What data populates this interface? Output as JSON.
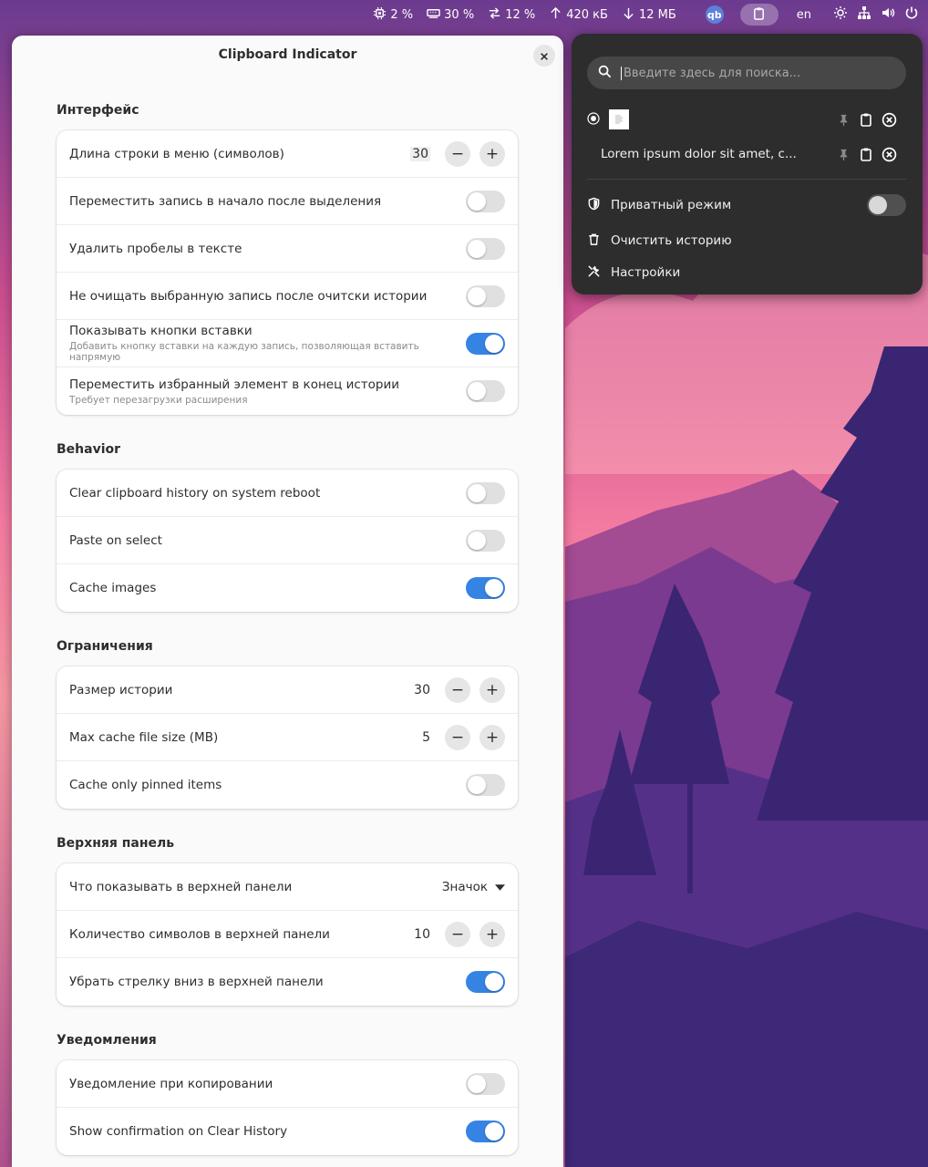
{
  "topbar": {
    "cpu": "2 %",
    "memory": "30 %",
    "swap": "12 %",
    "upload": "420 кБ",
    "download": "12 МБ",
    "app_badge": "qb",
    "keyboard_layout": "en"
  },
  "settings": {
    "title": "Clipboard Indicator",
    "sections": {
      "interface": {
        "title": "Интерфейс",
        "menu_line_length": {
          "label": "Длина строки в меню (символов)",
          "value": "30"
        },
        "move_to_top": {
          "label": "Переместить запись в начало после выделения",
          "on": false
        },
        "strip_whitespace": {
          "label": "Удалить пробелы в тексте",
          "on": false
        },
        "keep_selected": {
          "label": "Не очищать выбранную запись после очитски истории",
          "on": false
        },
        "show_paste_buttons": {
          "label": "Показывать кнопки вставки",
          "sub": "Добавить кнопку вставки на каждую запись, позволяющая вставить напрямую",
          "on": true
        },
        "pinned_to_bottom": {
          "label": "Переместить избранный элемент в конец истории",
          "sub": "Требует перезагрузки расширения",
          "on": false
        }
      },
      "behavior": {
        "title": "Behavior",
        "clear_on_reboot": {
          "label": "Clear clipboard history on system reboot",
          "on": false
        },
        "paste_on_select": {
          "label": "Paste on select",
          "on": false
        },
        "cache_images": {
          "label": "Cache images",
          "on": true
        }
      },
      "limits": {
        "title": "Ограничения",
        "history_size": {
          "label": "Размер истории",
          "value": "30"
        },
        "max_cache": {
          "label": "Max cache file size (MB)",
          "value": "5"
        },
        "cache_pinned_only": {
          "label": "Cache only pinned items",
          "on": false
        }
      },
      "top_panel": {
        "title": "Верхняя панель",
        "what_to_show": {
          "label": "Что показывать в верхней панели",
          "value": "Значок"
        },
        "char_count": {
          "label": "Количество символов в верхней панели",
          "value": "10"
        },
        "hide_arrow": {
          "label": "Убрать стрелку вниз в верхней панели",
          "on": true
        }
      },
      "notifications": {
        "title": "Уведомления",
        "notify_copy": {
          "label": "Уведомление при копировании",
          "on": false
        },
        "confirm_clear": {
          "label": "Show confirmation on Clear History",
          "on": true
        }
      }
    }
  },
  "popup": {
    "search_placeholder": "Введите здесь для поиска...",
    "items": [
      {
        "type": "image",
        "text": ""
      },
      {
        "type": "text",
        "text": "Lorem ipsum dolor sit amet, c..."
      }
    ],
    "private_mode": "Приватный режим",
    "private_on": false,
    "clear_history": "Очистить историю",
    "settings": "Настройки"
  },
  "colors": {
    "accent": "#3584e4",
    "popup_bg": "#2d2d2d",
    "window_bg": "#fafafa"
  }
}
